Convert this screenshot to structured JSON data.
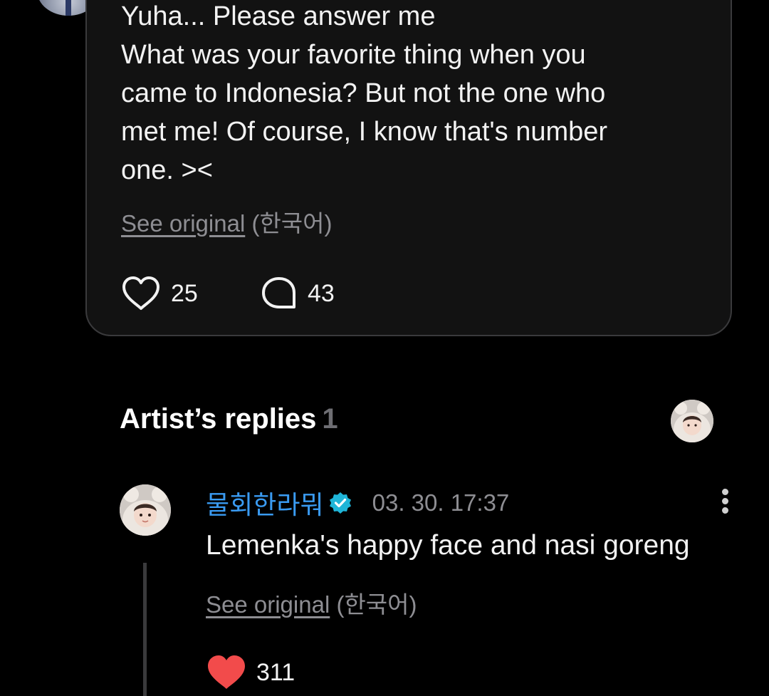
{
  "post": {
    "lines": [
      "Yuha... Please answer me",
      "What was your favorite thing when you",
      "came to Indonesia? But not the one who",
      "met me! Of course, I know that's number",
      "one. ><"
    ],
    "see_original_label": "See original",
    "language_label": "(한국어)",
    "like_count": "25",
    "comment_count": "43"
  },
  "artist_replies": {
    "title": "Artist’s replies",
    "count": "1"
  },
  "reply": {
    "author": "물회한라뭐",
    "verified": true,
    "timestamp": "03. 30. 17:37",
    "text": "Lemenka's happy face and nasi goreng",
    "see_original_label": "See original",
    "language_label": "(한국어)",
    "like_count": "311",
    "liked": true
  },
  "colors": {
    "background": "#000000",
    "card": "#121212",
    "card_border": "#3a3a3c",
    "author_name": "#3a9bf2",
    "verified_badge": "#1fb5d8",
    "liked_heart": "#f24b4b",
    "muted_text": "#8e8e93"
  },
  "icons": {
    "like": "heart-outline-icon",
    "comment": "speech-bubble-icon",
    "verified": "verified-badge-icon",
    "more": "more-vertical-icon",
    "liked": "heart-filled-icon"
  }
}
